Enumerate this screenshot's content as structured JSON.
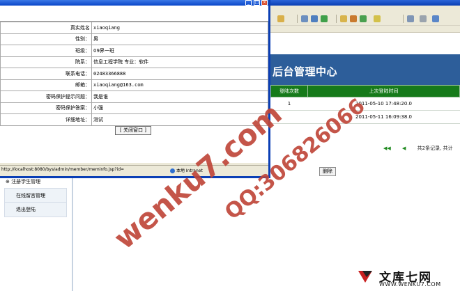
{
  "popup": {
    "fields": [
      {
        "label": "真实姓名",
        "value": "xiaoqiang"
      },
      {
        "label": "性别：",
        "value": "男"
      },
      {
        "label": "班级：",
        "value": "09界一班"
      },
      {
        "label": "院系：",
        "value": "信息工程学院  专业：软件"
      },
      {
        "label": "联系电话：",
        "value": "02483366888"
      },
      {
        "label": "邮箱：",
        "value": "xiaoqiang@163.com"
      },
      {
        "label": "密码保护提示问题：",
        "value": "我是谁"
      },
      {
        "label": "密码保护答案：",
        "value": "小强"
      },
      {
        "label": "详细地址：",
        "value": "测试"
      }
    ],
    "close_label": "[ 关闭窗口 ]",
    "status_url": "http://localhost:8080/bys/admin/member/meminfo.jsp?id=",
    "status_zone": "本地 Intranet"
  },
  "header": {
    "title": "后台管理中心"
  },
  "login_table": {
    "columns": [
      "登陆次数",
      "上次登陆时间"
    ],
    "rows": [
      {
        "count": "1",
        "time": "2011-05-10 17:48:20.0"
      },
      {
        "count": "",
        "time": "2011-05-11 16:09:38.0"
      }
    ]
  },
  "pager": {
    "summary": "共2条记录, 共计"
  },
  "delete_label": "删除",
  "sidebar": {
    "head": "注册学生管理",
    "items": [
      {
        "label": "在线留言管理"
      },
      {
        "label": "退出登陆"
      }
    ]
  },
  "watermark": {
    "text1": "wenku7.com",
    "text2": "QQ:306826066"
  },
  "footer_logo": {
    "name": "文库七网",
    "url": "WWW.WENKU7.COM"
  },
  "colors": {
    "header_bg": "#2d5e9a",
    "table_head_bg": "#167a1a",
    "watermark": "#c0473a"
  }
}
